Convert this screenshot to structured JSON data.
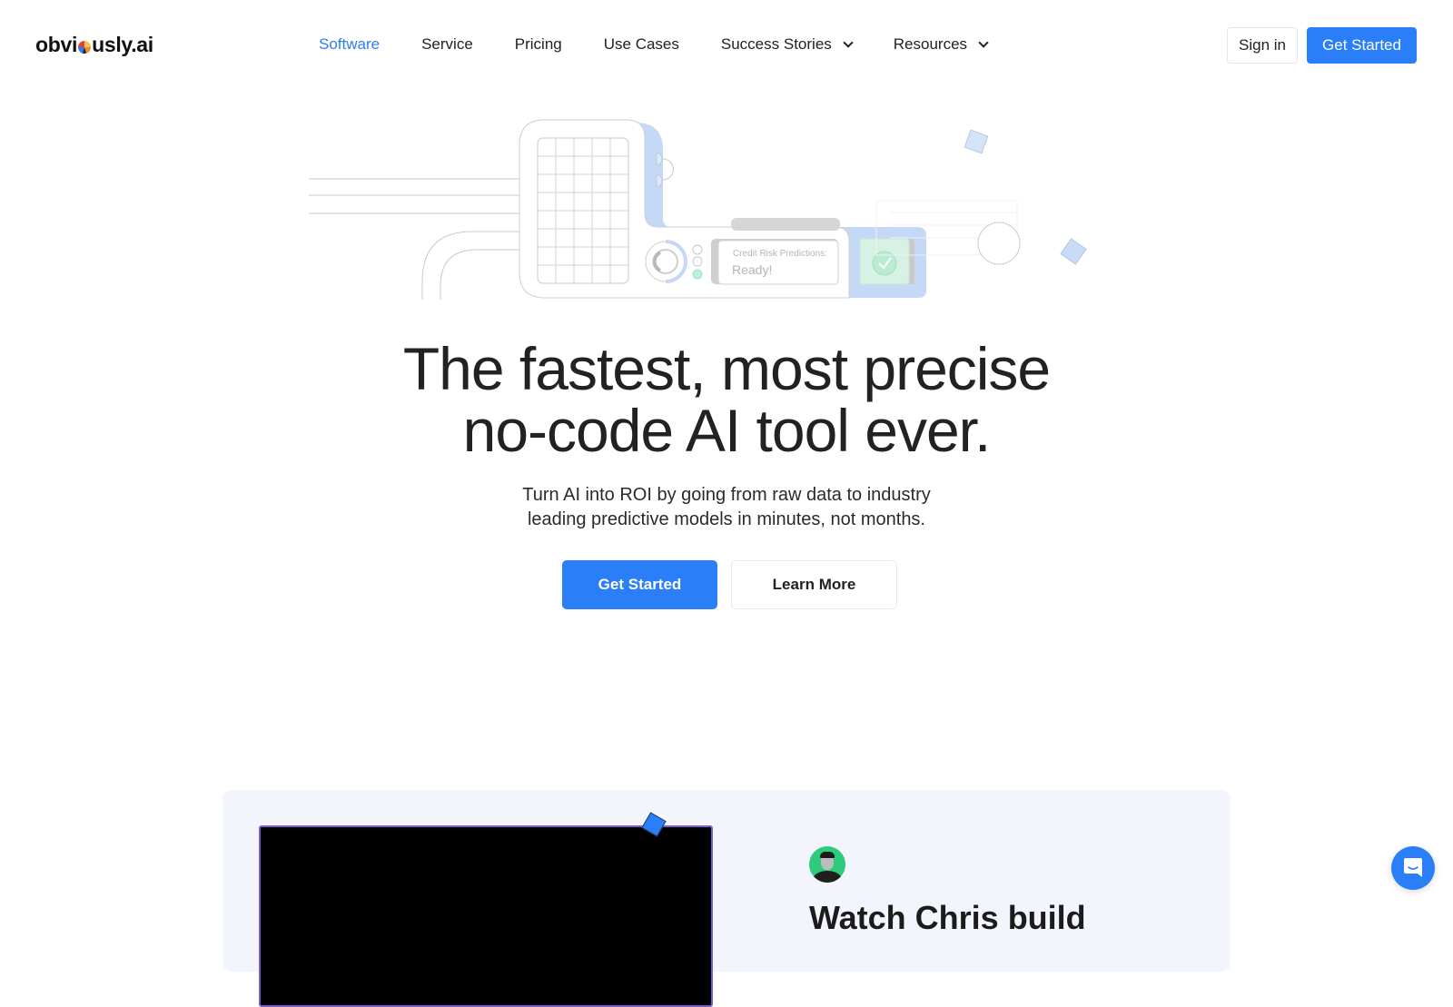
{
  "brand": {
    "name_prefix": "obvi",
    "name_suffix": "usly.ai",
    "accent_color": "#2a7ef7",
    "active_nav_color": "#2d7ff0"
  },
  "nav": {
    "items": [
      {
        "label": "Software",
        "active": true,
        "has_dropdown": false
      },
      {
        "label": "Service",
        "active": false,
        "has_dropdown": false
      },
      {
        "label": "Pricing",
        "active": false,
        "has_dropdown": false
      },
      {
        "label": "Use Cases",
        "active": false,
        "has_dropdown": false
      },
      {
        "label": "Success Stories",
        "active": false,
        "has_dropdown": true
      },
      {
        "label": "Resources",
        "active": false,
        "has_dropdown": true
      }
    ],
    "sign_in_label": "Sign in",
    "get_started_label": "Get Started"
  },
  "illustration": {
    "card_label": "Credit Risk Predictions:",
    "card_status": "Ready!",
    "icons": [
      "data-grid-icon",
      "dial-icon",
      "checkmark-icon"
    ]
  },
  "hero": {
    "title_line1": "The fastest, most precise",
    "title_line2": "no-code AI tool ever.",
    "subtitle_line1": "Turn AI into ROI by going from raw data to industry",
    "subtitle_line2": "leading predictive models in minutes, not months.",
    "primary_cta": "Get Started",
    "secondary_cta": "Learn More"
  },
  "video_section": {
    "heading": "Watch Chris build"
  },
  "chat_widget": {
    "icon": "chat-icon"
  }
}
